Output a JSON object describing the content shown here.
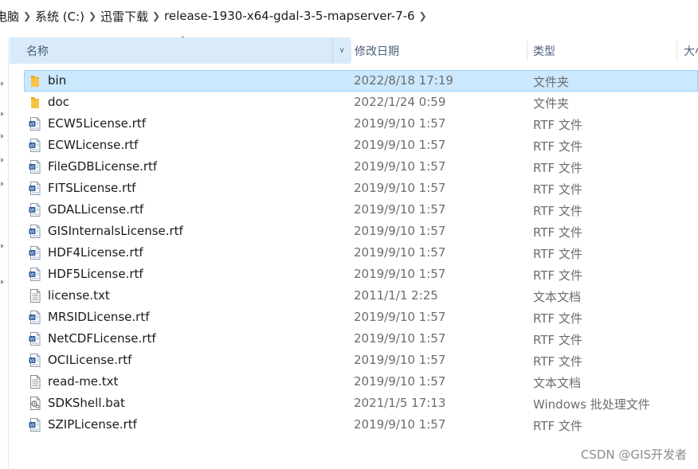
{
  "breadcrumb": {
    "items": [
      "电脑",
      "系统 (C:)",
      "迅雷下载",
      "release-1930-x64-gdal-3-5-mapserver-7-6"
    ]
  },
  "columns": {
    "name": "名称",
    "date": "修改日期",
    "type": "类型",
    "size": "大小"
  },
  "files": [
    {
      "name": "bin",
      "date": "2022/8/18 17:19",
      "type": "文件夹",
      "icon": "folder-icon",
      "selected": true
    },
    {
      "name": "doc",
      "date": "2022/1/24 0:59",
      "type": "文件夹",
      "icon": "folder-icon"
    },
    {
      "name": "ECW5License.rtf",
      "date": "2019/9/10 1:57",
      "type": "RTF 文件",
      "icon": "rtf-file-icon"
    },
    {
      "name": "ECWLicense.rtf",
      "date": "2019/9/10 1:57",
      "type": "RTF 文件",
      "icon": "rtf-file-icon"
    },
    {
      "name": "FileGDBLicense.rtf",
      "date": "2019/9/10 1:57",
      "type": "RTF 文件",
      "icon": "rtf-file-icon"
    },
    {
      "name": "FITSLicense.rtf",
      "date": "2019/9/10 1:57",
      "type": "RTF 文件",
      "icon": "rtf-file-icon"
    },
    {
      "name": "GDALLicense.rtf",
      "date": "2019/9/10 1:57",
      "type": "RTF 文件",
      "icon": "rtf-file-icon"
    },
    {
      "name": "GISInternalsLicense.rtf",
      "date": "2019/9/10 1:57",
      "type": "RTF 文件",
      "icon": "rtf-file-icon"
    },
    {
      "name": "HDF4License.rtf",
      "date": "2019/9/10 1:57",
      "type": "RTF 文件",
      "icon": "rtf-file-icon"
    },
    {
      "name": "HDF5License.rtf",
      "date": "2019/9/10 1:57",
      "type": "RTF 文件",
      "icon": "rtf-file-icon"
    },
    {
      "name": "license.txt",
      "date": "2011/1/1 2:25",
      "type": "文本文档",
      "icon": "txt-file-icon"
    },
    {
      "name": "MRSIDLicense.rtf",
      "date": "2019/9/10 1:57",
      "type": "RTF 文件",
      "icon": "rtf-file-icon"
    },
    {
      "name": "NetCDFLicense.rtf",
      "date": "2019/9/10 1:57",
      "type": "RTF 文件",
      "icon": "rtf-file-icon"
    },
    {
      "name": "OCILicense.rtf",
      "date": "2019/9/10 1:57",
      "type": "RTF 文件",
      "icon": "rtf-file-icon"
    },
    {
      "name": "read-me.txt",
      "date": "2019/9/10 1:57",
      "type": "文本文档",
      "icon": "txt-file-icon"
    },
    {
      "name": "SDKShell.bat",
      "date": "2021/1/5 17:13",
      "type": "Windows 批处理文件",
      "icon": "bat-file-icon"
    },
    {
      "name": "SZIPLicense.rtf",
      "date": "2019/9/10 1:57",
      "type": "RTF 文件",
      "icon": "rtf-file-icon"
    }
  ],
  "watermark": "CSDN @GIS开发者",
  "colors": {
    "selection": "#cce8ff",
    "header_hover": "#d9ebf9",
    "header_text": "#4c607a",
    "folder": "#f6c344"
  }
}
